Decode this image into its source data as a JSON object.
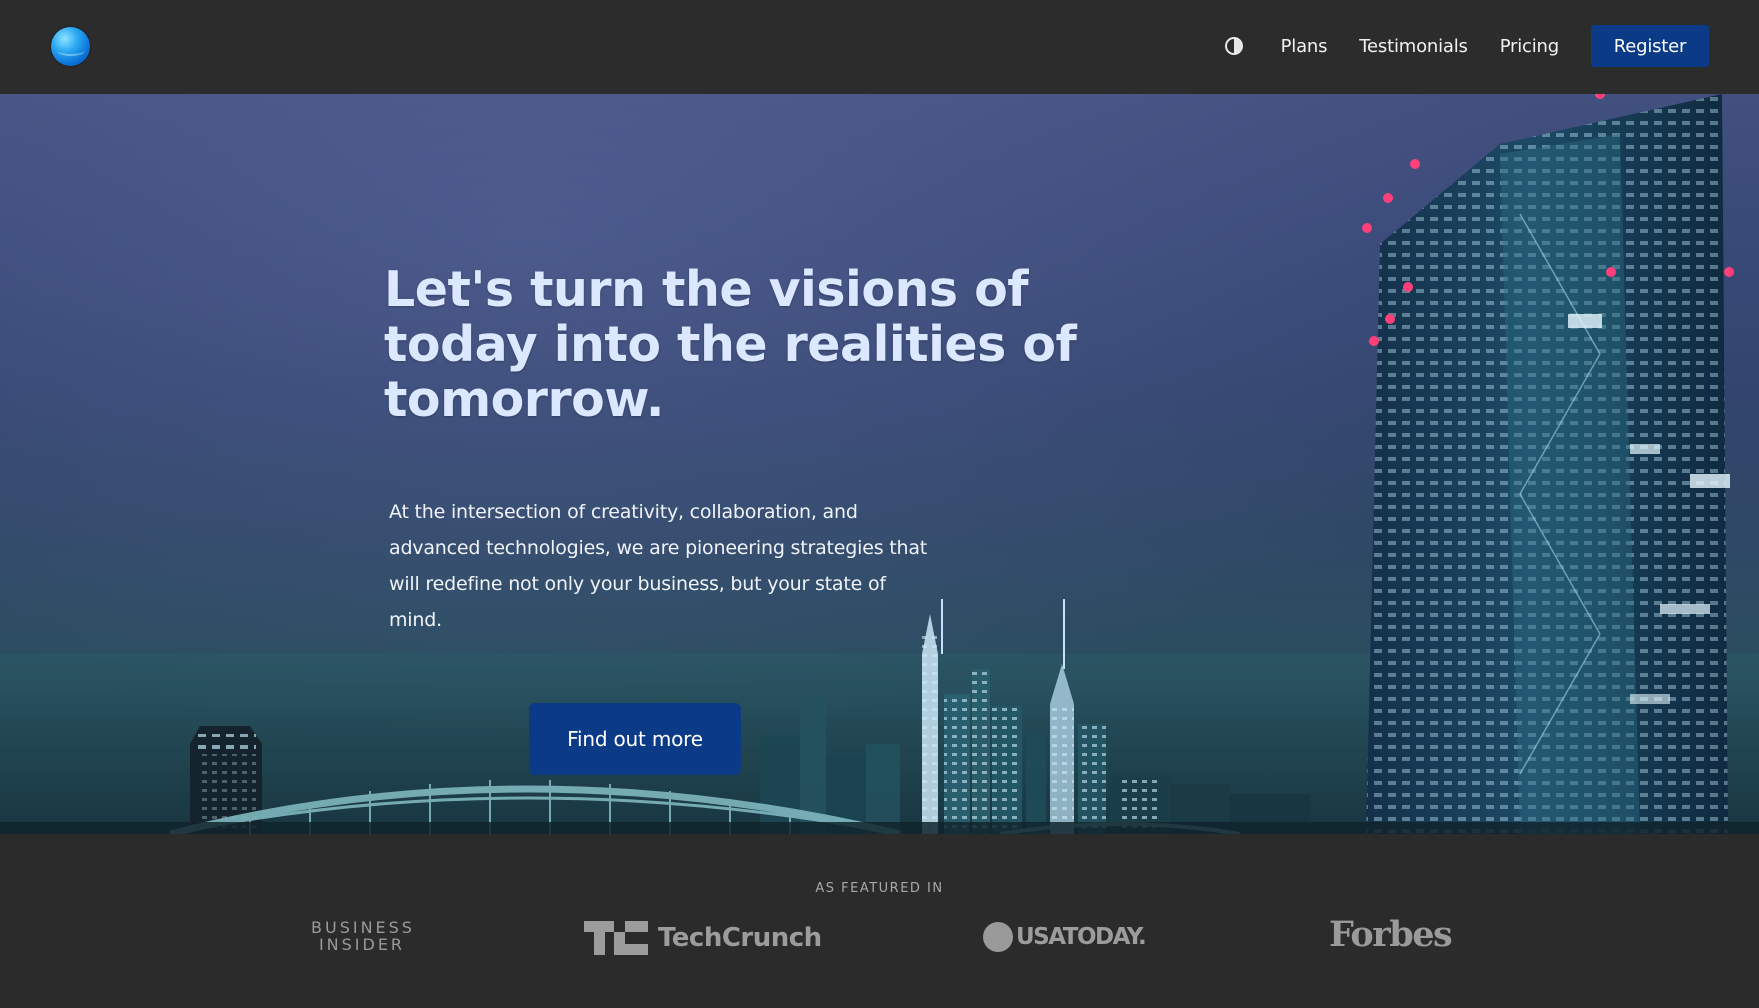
{
  "header": {
    "logo_icon": "globe-logo-icon",
    "theme_toggle_icon": "contrast-half-circle-icon",
    "nav": [
      {
        "label": "Plans"
      },
      {
        "label": "Testimonials"
      },
      {
        "label": "Pricing"
      }
    ],
    "register_label": "Register"
  },
  "hero": {
    "headline": "Let's turn the visions of today into the realities of tomorrow.",
    "subtext": "At the intersection of creativity, collaboration, and advanced technologies, we are pioneering strategies that will redefine not only your business, but your state of mind.",
    "cta_label": "Find out more",
    "background": "night city skyline with bridge and illuminated skyscraper"
  },
  "featured": {
    "label": "AS FEATURED IN",
    "logos": [
      {
        "name": "BUSINESS INSIDER",
        "line1": "BUSINESS",
        "line2": "INSIDER"
      },
      {
        "name": "TechCrunch",
        "mark": "TC",
        "word": "TechCrunch"
      },
      {
        "name": "USA TODAY",
        "word": "USATODAY."
      },
      {
        "name": "Forbes",
        "word": "Forbes"
      }
    ]
  },
  "colors": {
    "header_bg": "#2c2c2c",
    "accent_button": "#0b3a86",
    "headline_text": "#dce8ff",
    "featured_bg": "#2b2b2b",
    "logo_gray": "#9a9a9a"
  }
}
